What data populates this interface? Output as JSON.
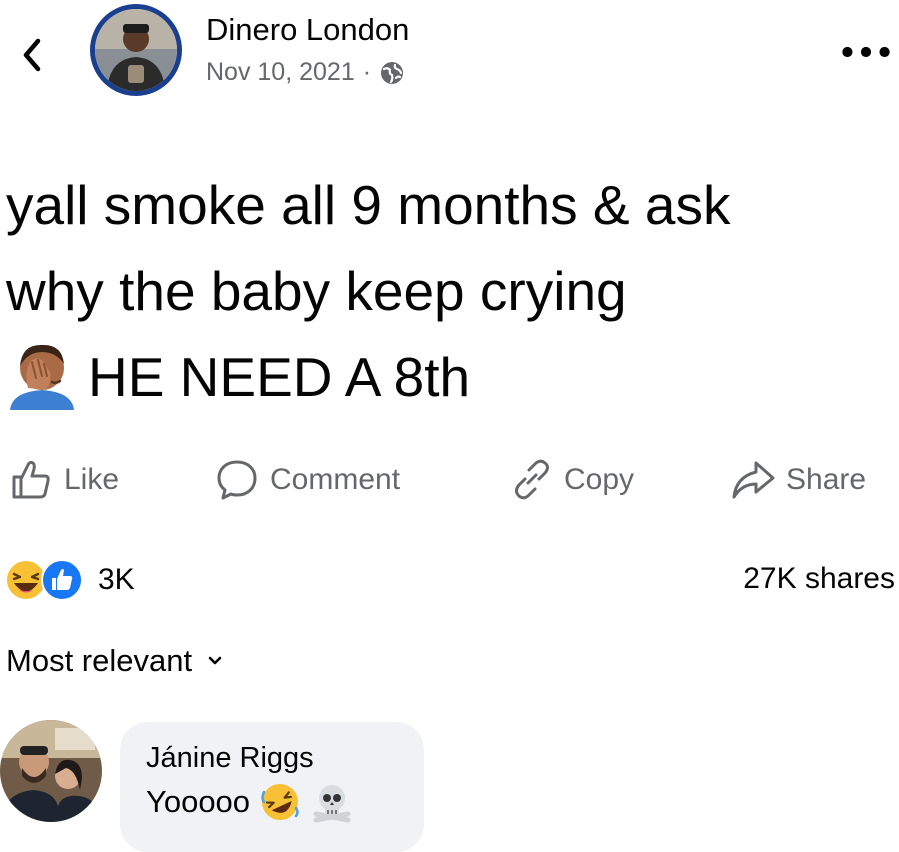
{
  "header": {
    "back_icon": "chevron-left-icon",
    "author_name": "Dinero London",
    "date": "Nov 10, 2021",
    "separator": "·",
    "privacy_icon": "globe-icon",
    "more_label": "•••"
  },
  "post": {
    "line1": "yall smoke all 9 months & ask",
    "line2": "why the baby keep crying",
    "line3_emoji": "facepalm-emoji",
    "line3": "HE NEED A 8th"
  },
  "actions": {
    "like": "Like",
    "comment": "Comment",
    "copy": "Copy",
    "share": "Share"
  },
  "stats": {
    "reactions_icons": [
      "haha-reaction-icon",
      "like-reaction-icon"
    ],
    "reaction_count": "3K",
    "shares": "27K shares"
  },
  "comments": {
    "sort_label": "Most relevant",
    "items": [
      {
        "author": "Jánine Riggs",
        "text": "Yooooo",
        "emojis": [
          "rofl-emoji",
          "skull-crossbones-emoji"
        ]
      }
    ]
  },
  "colors": {
    "text": "#050505",
    "secondary": "#65676b",
    "avatar_ring": "#1b3f8f",
    "like_blue": "#1877f2",
    "bubble": "#f0f2f5"
  }
}
